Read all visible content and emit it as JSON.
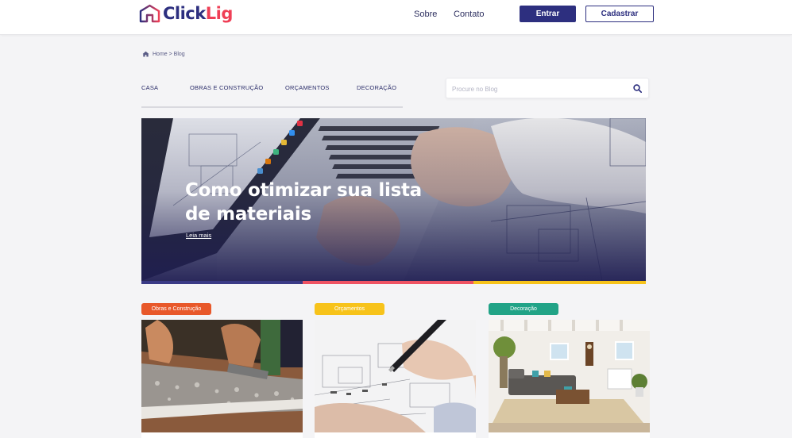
{
  "header": {
    "logo": {
      "click": "Click",
      "lig": "Lig"
    },
    "nav": [
      {
        "label": "Sobre"
      },
      {
        "label": "Contato"
      }
    ],
    "login_label": "Entrar",
    "signup_label": "Cadastrar"
  },
  "breadcrumb": {
    "text": "Home > Blog",
    "icon": "home-icon"
  },
  "categories": [
    {
      "label": "CASA"
    },
    {
      "label": "OBRAS E CONSTRUÇÃO"
    },
    {
      "label": "ORÇAMENTOS"
    },
    {
      "label": "DECORAÇÃO"
    }
  ],
  "search": {
    "placeholder": "Procure no Blog",
    "value": "",
    "icon": "search-icon"
  },
  "hero": {
    "title": "Como otimizar sua lista de materiais",
    "link_label": "Leia mais"
  },
  "cards": [
    {
      "tag": "Obras e Construção",
      "tag_color": "#e8582a"
    },
    {
      "tag": "Orçamentos",
      "tag_color": "#f7c31b"
    },
    {
      "tag": "Decoração",
      "tag_color": "#21a387"
    }
  ],
  "colors": {
    "brand": "#2d2f7f",
    "accent": "#ef3f56",
    "bar": [
      "#3a3a86",
      "#ef5363",
      "#f7c31b"
    ]
  }
}
